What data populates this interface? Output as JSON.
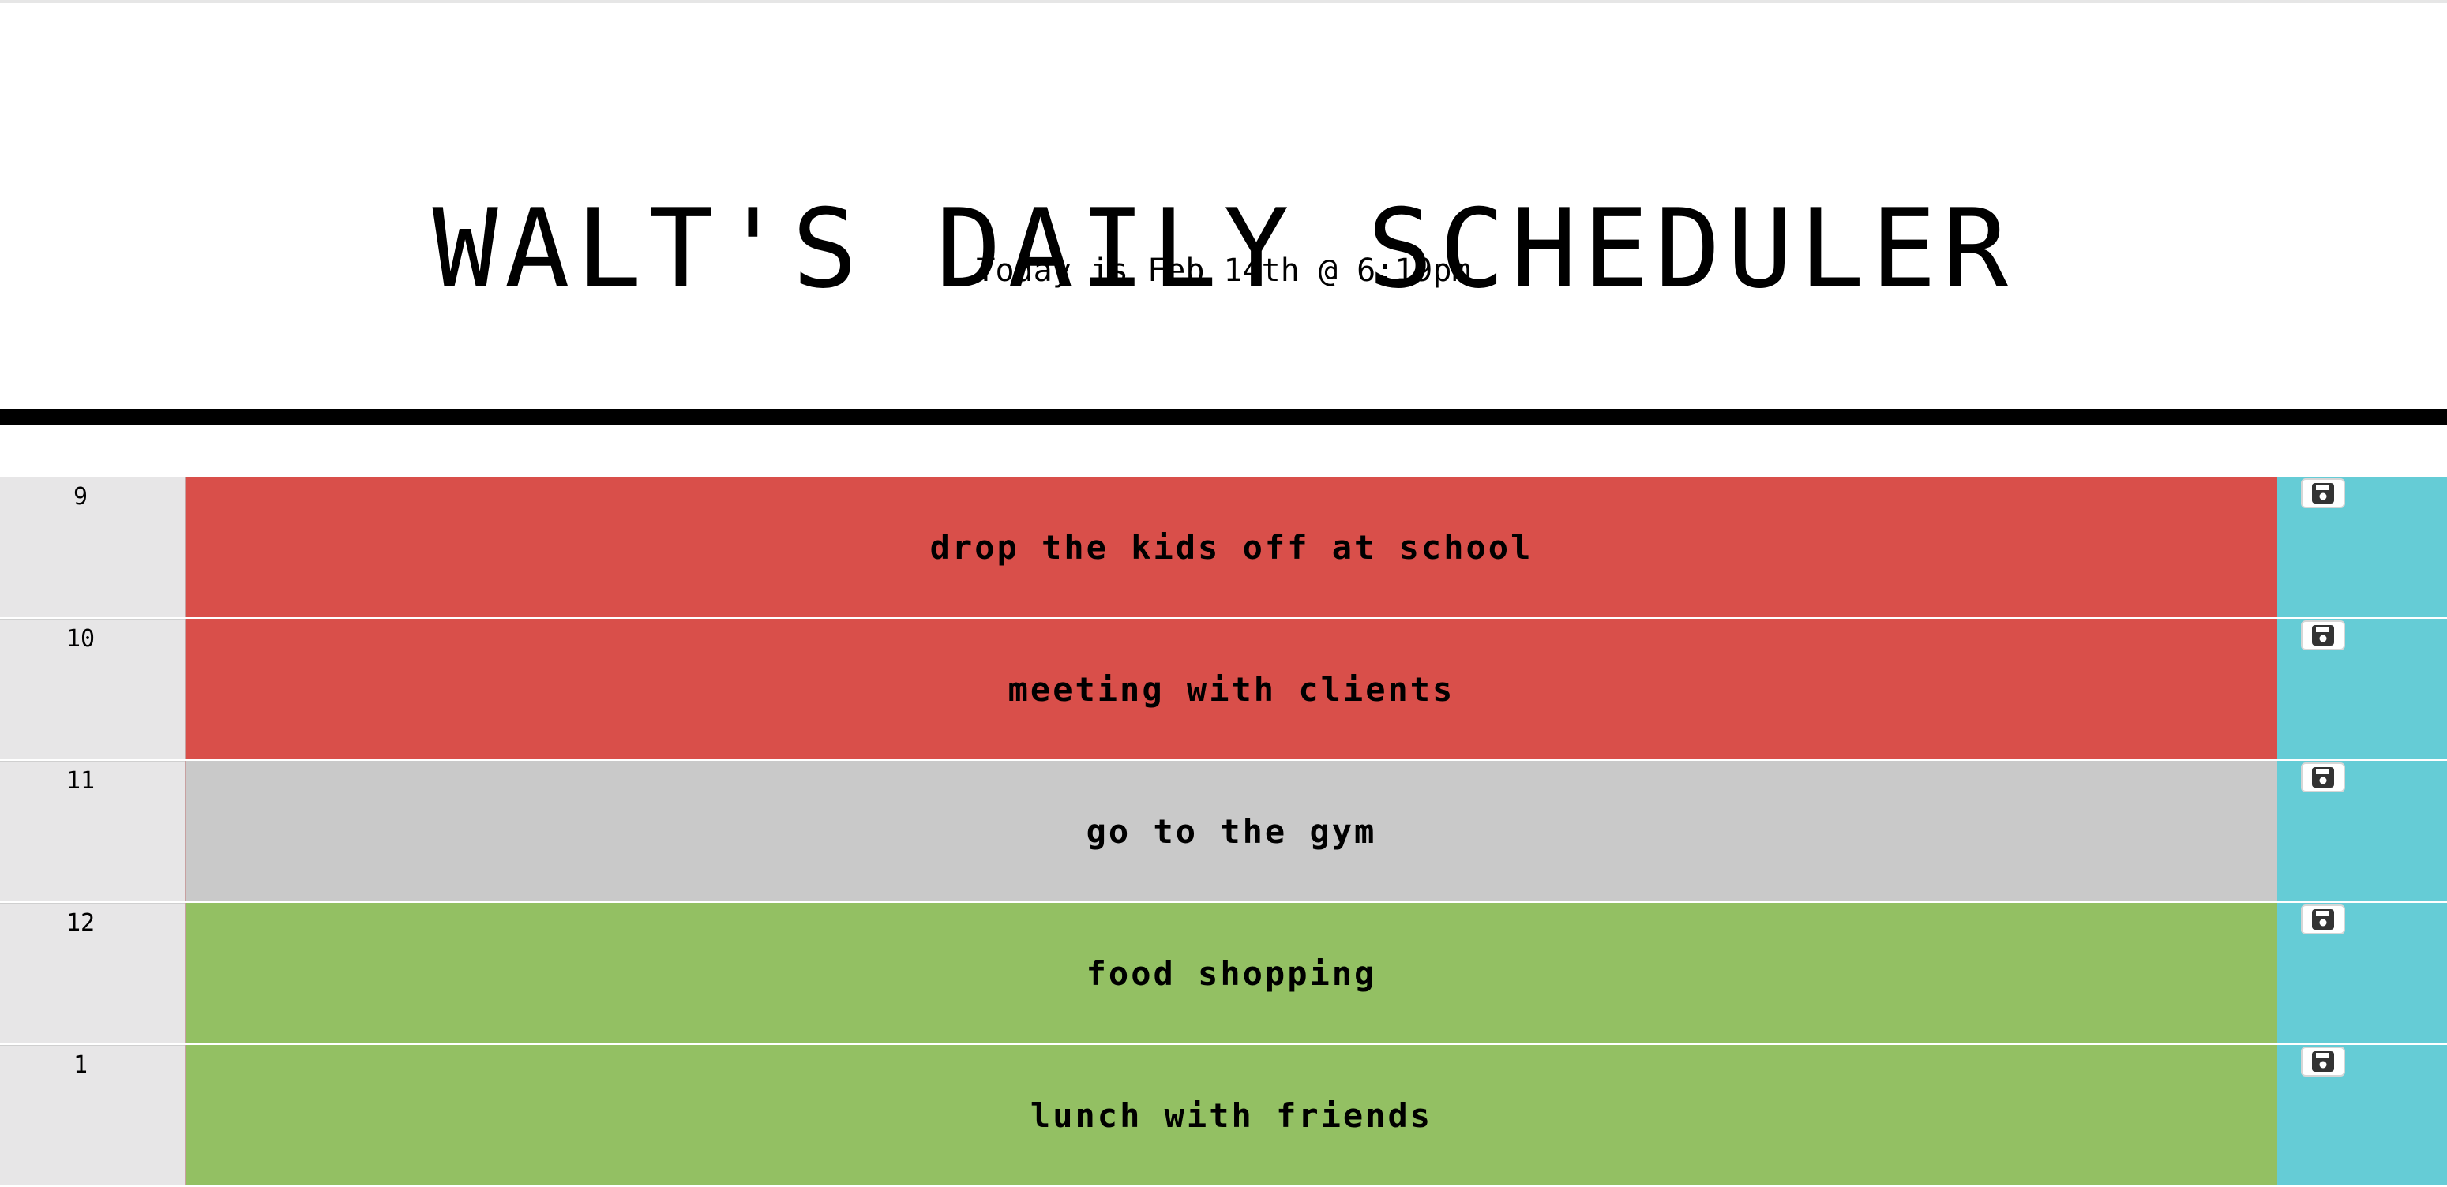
{
  "header": {
    "title": "WALT'S DAILY SCHEDULER",
    "subtitle": "Today is Feb 14th @ 6:19pm"
  },
  "colors": {
    "past": "#d94f4a",
    "present": "#c9c9c9",
    "future": "#93c063",
    "save_column": "#65ccd6",
    "hour_column": "#e7e6e7"
  },
  "schedule": [
    {
      "hour": "9",
      "description": "drop the kids off at school",
      "status": "past",
      "icon": "save-icon"
    },
    {
      "hour": "10",
      "description": "meeting with clients",
      "status": "past",
      "icon": "save-icon"
    },
    {
      "hour": "11",
      "description": "go to the gym",
      "status": "present",
      "icon": "save-icon"
    },
    {
      "hour": "12",
      "description": "food shopping",
      "status": "future",
      "icon": "save-icon"
    },
    {
      "hour": "1",
      "description": "lunch with friends",
      "status": "future",
      "icon": "save-icon"
    }
  ]
}
